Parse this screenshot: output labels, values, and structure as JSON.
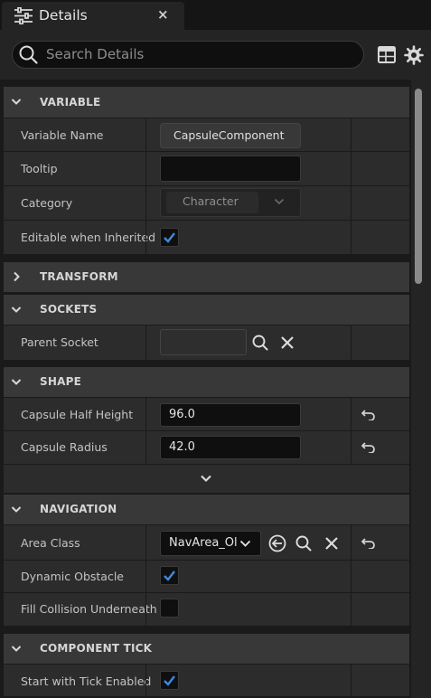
{
  "tab": {
    "title": "Details",
    "close": "×"
  },
  "search": {
    "placeholder": "Search Details"
  },
  "categories": {
    "variable": "VARIABLE",
    "transform": "TRANSFORM",
    "sockets": "SOCKETS",
    "shape": "SHAPE",
    "navigation": "NAVIGATION",
    "component_tick": "COMPONENT TICK"
  },
  "variable": {
    "variable_name_label": "Variable Name",
    "variable_name_value": "CapsuleComponent",
    "tooltip_label": "Tooltip",
    "tooltip_value": "",
    "category_label": "Category",
    "category_value": "Character",
    "editable_label": "Editable when Inherited",
    "editable_checked": true
  },
  "sockets": {
    "parent_socket_label": "Parent Socket",
    "parent_socket_value": ""
  },
  "shape": {
    "half_height_label": "Capsule Half Height",
    "half_height_value": "96.0",
    "radius_label": "Capsule Radius",
    "radius_value": "42.0"
  },
  "navigation": {
    "area_class_label": "Area Class",
    "area_class_value": "NavArea_Ol",
    "dynamic_obstacle_label": "Dynamic Obstacle",
    "dynamic_obstacle_checked": true,
    "fill_collision_label": "Fill Collision Underneath",
    "fill_collision_checked": false
  },
  "component_tick": {
    "start_tick_label": "Start with Tick Enabled",
    "start_tick_checked": true
  },
  "colors": {
    "accent": "#3d8be0",
    "panel": "#242424",
    "row": "#2c2c2c",
    "category": "#383838"
  }
}
